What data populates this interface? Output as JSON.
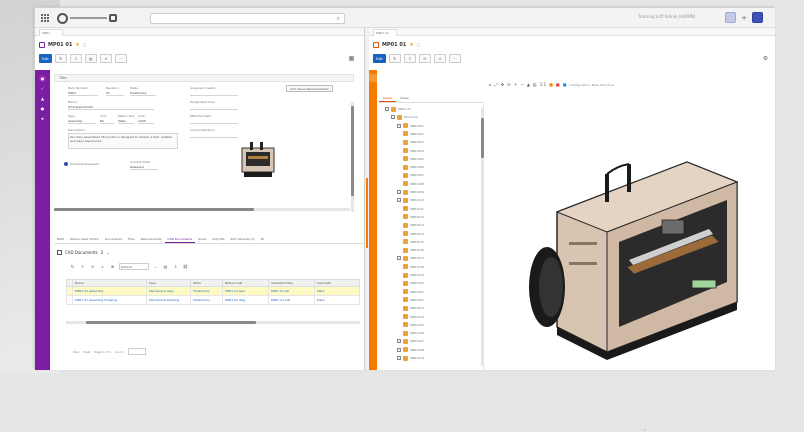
{
  "topbar": {
    "menu_icon": "grid-menu-icon",
    "search_icon": "search-icon",
    "user_label": "Tracking Left Admin (ADMIN)"
  },
  "left_pane": {
    "tab_label": "MP01",
    "title": "MP01 01",
    "toolbar": {
      "edit_label": "Edit"
    },
    "form": {
      "header": "Title",
      "fields": [
        {
          "label": "Item Number",
          "value": "MP01"
        },
        {
          "label": "Revision",
          "value": "01"
        },
        {
          "label": "State",
          "value": "Preliminary"
        },
        {
          "label": "Name",
          "value": "Prototype Printer"
        },
        {
          "label": "Type",
          "value": "Assembly"
        },
        {
          "label": "Unit",
          "value": "EA"
        },
        {
          "label": "Make / Buy",
          "value": "Make"
        },
        {
          "label": "Cost",
          "value": "1000"
        },
        {
          "label": "Assigned Creator",
          "value": ""
        },
        {
          "label": "Designated User",
          "value": ""
        },
        {
          "label": "Effective Date",
          "value": ""
        },
        {
          "label": "Current Revision",
          "value": ""
        },
        {
          "label": "Description",
          "value": "Our fully assembled 3D printer is designed to deliver a fast, reliable and easy experience."
        }
      ],
      "attach_button": "Add Visual Representation",
      "checkbox_label": "Prototype Released",
      "current_state_label": "Current State",
      "current_state_value": "Released"
    },
    "subtabs": [
      "BOM",
      "Where Used (Parts)",
      "Documents",
      "Files",
      "Requirements",
      "CAD Documents",
      "Goals",
      "Signoffs",
      "Part Variants (X)",
      "Bl"
    ],
    "active_subtab": "CAD Documents",
    "grid": {
      "title": "CAD Documents",
      "count": "2",
      "view_select": "Default",
      "columns": [
        "",
        "Name",
        "Type",
        "State",
        "Native CAD",
        "Viewable Data",
        "Generate"
      ],
      "rows": [
        [
          "",
          "MP01 01 Assembly",
          "Mechanical Assy",
          "Preliminary",
          "MP01 01.asm",
          "MP01 01.ipt",
          "Mark"
        ],
        [
          "",
          "MP01 01 Assembly Drawing",
          "Mechanical Drawing",
          "Preliminary",
          "MP01 01.dwg",
          "MP01 01.pdf",
          "Mark"
        ]
      ]
    },
    "pager": {
      "prev": "Prev",
      "next": "Next",
      "page": "Page 1 of 1",
      "goto": "Go to"
    }
  },
  "right_pane": {
    "tab_label": "MP01 01",
    "title": "MP01 01",
    "toolbar": {
      "edit_label": "Edit"
    },
    "tree_tabs": [
      "Model",
      "Views"
    ],
    "tree": [
      {
        "label": "MP01 01",
        "level": 0
      },
      {
        "label": "Structure",
        "level": 1
      },
      {
        "label": "MP01001",
        "level": 2
      },
      {
        "label": "MP01002",
        "level": 3
      },
      {
        "label": "MP01003",
        "level": 3
      },
      {
        "label": "MP01004",
        "level": 3
      },
      {
        "label": "MP01005",
        "level": 3
      },
      {
        "label": "MP01006",
        "level": 3
      },
      {
        "label": "MP01007",
        "level": 3
      },
      {
        "label": "MP01008",
        "level": 3
      },
      {
        "label": "MP01009",
        "level": 2
      },
      {
        "label": "MP01010",
        "level": 2
      },
      {
        "label": "MP01011",
        "level": 3
      },
      {
        "label": "MP01012",
        "level": 3
      },
      {
        "label": "MP01013",
        "level": 3
      },
      {
        "label": "MP01014",
        "level": 3
      },
      {
        "label": "MP01015",
        "level": 3
      },
      {
        "label": "MP01016",
        "level": 3
      },
      {
        "label": "MP01017",
        "level": 2
      },
      {
        "label": "MP01018",
        "level": 3
      },
      {
        "label": "MP01019",
        "level": 3
      },
      {
        "label": "MP01020",
        "level": 3
      },
      {
        "label": "MP01021",
        "level": 3
      },
      {
        "label": "MP01022",
        "level": 3
      },
      {
        "label": "MP01023",
        "level": 3
      },
      {
        "label": "MP01024",
        "level": 3
      },
      {
        "label": "MP01025",
        "level": 3
      },
      {
        "label": "MP01026",
        "level": 3
      },
      {
        "label": "MP01027",
        "level": 2
      },
      {
        "label": "MP01028",
        "level": 2
      },
      {
        "label": "MP01029",
        "level": 2
      }
    ],
    "viewer_toolbar": {
      "mode_label": "Configuration: Base Structure",
      "zoom_label": "1:1"
    }
  },
  "colors": {
    "left_accent": "#7b1fa2",
    "right_accent": "#f57c00",
    "primary_button": "#1565c0"
  }
}
